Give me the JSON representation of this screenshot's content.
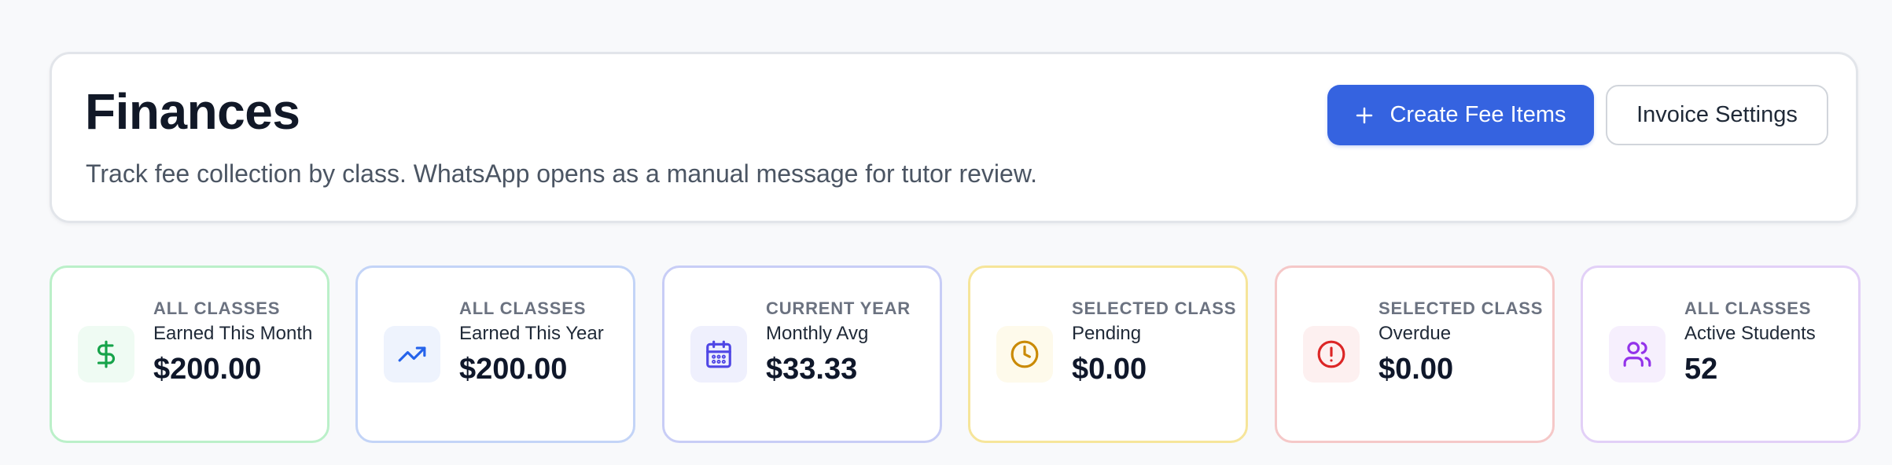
{
  "header": {
    "title": "Finances",
    "subtitle": "Track fee collection by class. WhatsApp opens as a manual message for tutor review.",
    "create_button_label": "Create Fee Items",
    "settings_button_label": "Invoice Settings"
  },
  "colors": {
    "primary": "#3563e0",
    "green": "#16a34a",
    "blue": "#2563eb",
    "indigo": "#4f46e5",
    "amber": "#ca8a04",
    "red": "#dc2626",
    "purple": "#9333ea"
  },
  "stats": [
    {
      "scope": "ALL CLASSES",
      "label": "Earned This Month",
      "value": "$200.00",
      "icon": "dollar-icon"
    },
    {
      "scope": "ALL CLASSES",
      "label": "Earned This Year",
      "value": "$200.00",
      "icon": "trending-up-icon"
    },
    {
      "scope": "CURRENT YEAR",
      "label": "Monthly Avg",
      "value": "$33.33",
      "icon": "calendar-icon"
    },
    {
      "scope": "SELECTED CLASS",
      "label": "Pending",
      "value": "$0.00",
      "icon": "clock-icon"
    },
    {
      "scope": "SELECTED CLASS",
      "label": "Overdue",
      "value": "$0.00",
      "icon": "alert-circle-icon"
    },
    {
      "scope": "ALL CLASSES",
      "label": "Active Students",
      "value": "52",
      "icon": "users-icon"
    }
  ]
}
